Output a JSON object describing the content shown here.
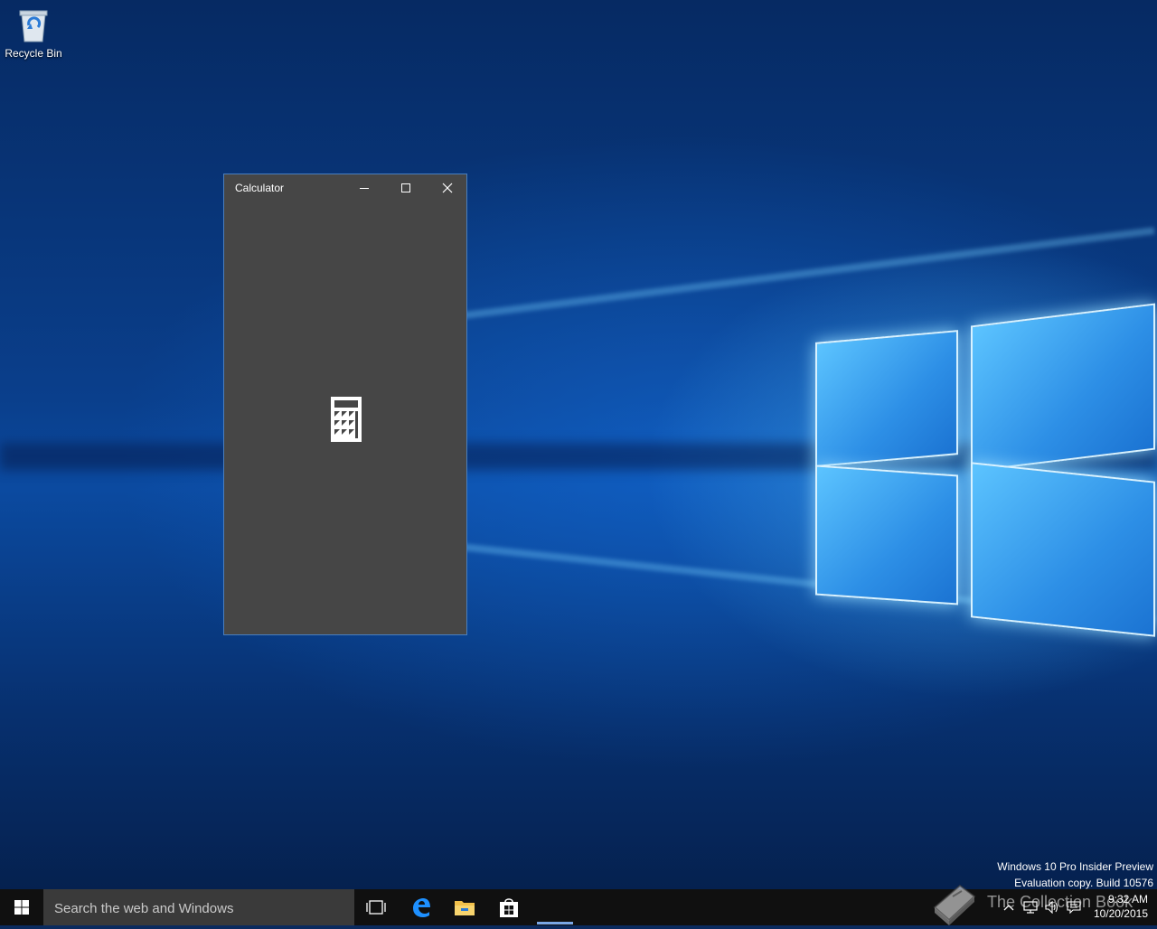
{
  "desktop": {
    "icons": [
      {
        "label": "Recycle Bin",
        "icon": "recycle-bin-icon"
      }
    ]
  },
  "calculator": {
    "title": "Calculator",
    "controls": {
      "minimize": "minimize-icon",
      "maximize": "maximize-icon",
      "close": "close-icon"
    },
    "splash_icon": "calculator-icon",
    "background": "#464646"
  },
  "watermark": {
    "line1": "Windows 10 Pro Insider Preview",
    "line2": "Evaluation copy. Build 10576"
  },
  "taskbar": {
    "search_placeholder": "Search the web and Windows",
    "pinned": [
      "task-view-icon",
      "edge-icon",
      "file-explorer-icon",
      "store-icon"
    ],
    "tray": {
      "time": "9:32 AM",
      "date": "10/20/2015"
    }
  },
  "overlay": {
    "brand_text": "The Collection Book"
  }
}
